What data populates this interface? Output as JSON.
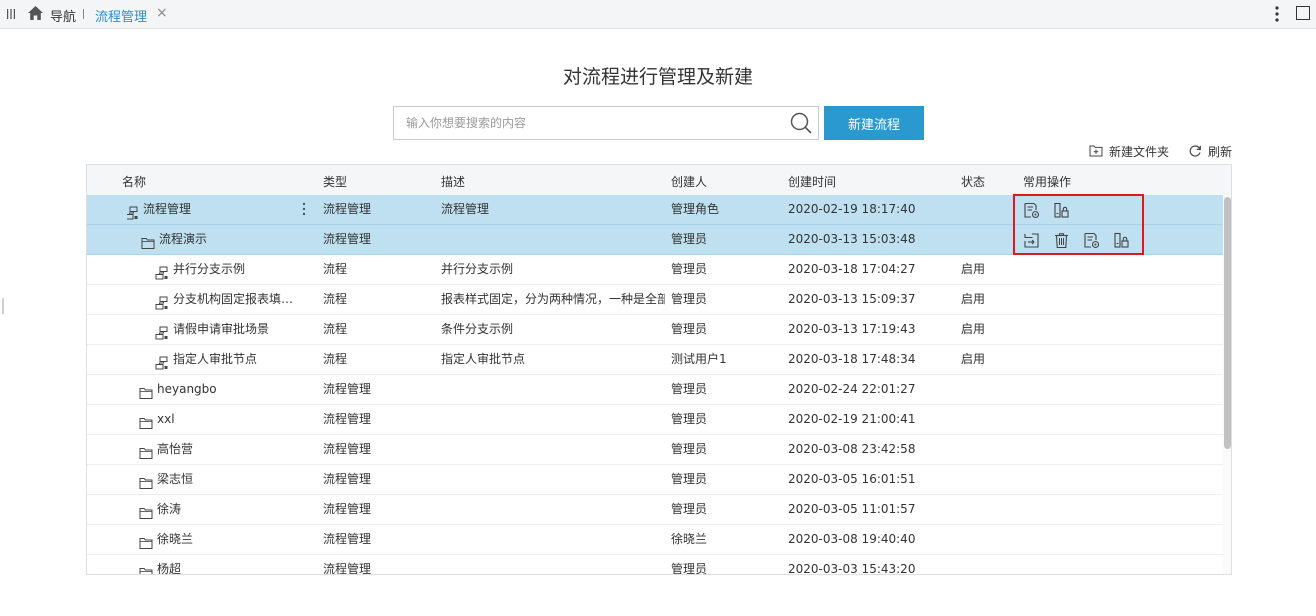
{
  "topbar": {
    "nav_label": "导航",
    "active_tab": "流程管理",
    "close_glyph": "×",
    "icons": [
      "menu-icon",
      "home-icon",
      "kebab-icon",
      "window-icon"
    ]
  },
  "page": {
    "title": "对流程进行管理及新建"
  },
  "search": {
    "placeholder": "输入你想要搜索的内容",
    "value": ""
  },
  "actions": {
    "new_flow": "新建流程",
    "new_folder": "新建文件夹",
    "refresh": "刷新"
  },
  "table": {
    "columns": {
      "name": "名称",
      "type": "类型",
      "desc": "描述",
      "creator": "创建人",
      "time": "创建时间",
      "status": "状态",
      "ops": "常用操作"
    },
    "rows": [
      {
        "name": "流程管理",
        "icon": "process-icon",
        "type": "流程管理",
        "desc": "流程管理",
        "creator": "管理角色",
        "time": "2020-02-19 18:17:40",
        "status": "",
        "selected": true,
        "ops": [
          "edit-form-icon",
          "permission-icon"
        ],
        "more": true
      },
      {
        "name": "流程演示",
        "icon": "folder-icon",
        "type": "流程管理",
        "desc": "",
        "creator": "管理员",
        "time": "2020-03-13 15:03:48",
        "status": "",
        "selected": true,
        "ops": [
          "move-in-icon",
          "delete-icon",
          "edit-form-icon",
          "permission-icon"
        ]
      },
      {
        "name": "并行分支示例",
        "icon": "process-icon",
        "type": "流程",
        "desc": "并行分支示例",
        "creator": "管理员",
        "time": "2020-03-18 17:04:27",
        "status": "启用"
      },
      {
        "name": "分支机构固定报表填报...",
        "icon": "process-icon",
        "type": "流程",
        "desc": "报表样式固定，分为两种情况，一种是全部",
        "creator": "管理员",
        "time": "2020-03-13 15:09:37",
        "status": "启用"
      },
      {
        "name": "请假申请审批场景",
        "icon": "process-icon",
        "type": "流程",
        "desc": "条件分支示例",
        "creator": "管理员",
        "time": "2020-03-13 17:19:43",
        "status": "启用"
      },
      {
        "name": "指定人审批节点",
        "icon": "process-icon",
        "type": "流程",
        "desc": "指定人审批节点",
        "creator": "测试用户1",
        "time": "2020-03-18 17:48:34",
        "status": "启用"
      },
      {
        "name": "heyangbo",
        "icon": "folder-icon",
        "type": "流程管理",
        "desc": "",
        "creator": "管理员",
        "time": "2020-02-24 22:01:27",
        "status": ""
      },
      {
        "name": "xxl",
        "icon": "folder-icon",
        "type": "流程管理",
        "desc": "",
        "creator": "管理员",
        "time": "2020-02-19 21:00:41",
        "status": ""
      },
      {
        "name": "高怡营",
        "icon": "folder-icon",
        "type": "流程管理",
        "desc": "",
        "creator": "管理员",
        "time": "2020-03-08 23:42:58",
        "status": ""
      },
      {
        "name": "梁志恒",
        "icon": "folder-icon",
        "type": "流程管理",
        "desc": "",
        "creator": "管理员",
        "time": "2020-03-05 16:01:51",
        "status": ""
      },
      {
        "name": "徐涛",
        "icon": "folder-icon",
        "type": "流程管理",
        "desc": "",
        "creator": "管理员",
        "time": "2020-03-05 11:01:57",
        "status": ""
      },
      {
        "name": "徐晓兰",
        "icon": "folder-icon",
        "type": "流程管理",
        "desc": "",
        "creator": "徐晓兰",
        "time": "2020-03-08 19:40:40",
        "status": ""
      },
      {
        "name": "杨超",
        "icon": "folder-icon",
        "type": "流程管理",
        "desc": "",
        "creator": "管理员",
        "time": "2020-03-03 15:43:20",
        "status": ""
      }
    ]
  },
  "colors": {
    "accent": "#2a99d0",
    "selected_row": "#bfe0f0",
    "highlight_box": "#e0181d"
  }
}
